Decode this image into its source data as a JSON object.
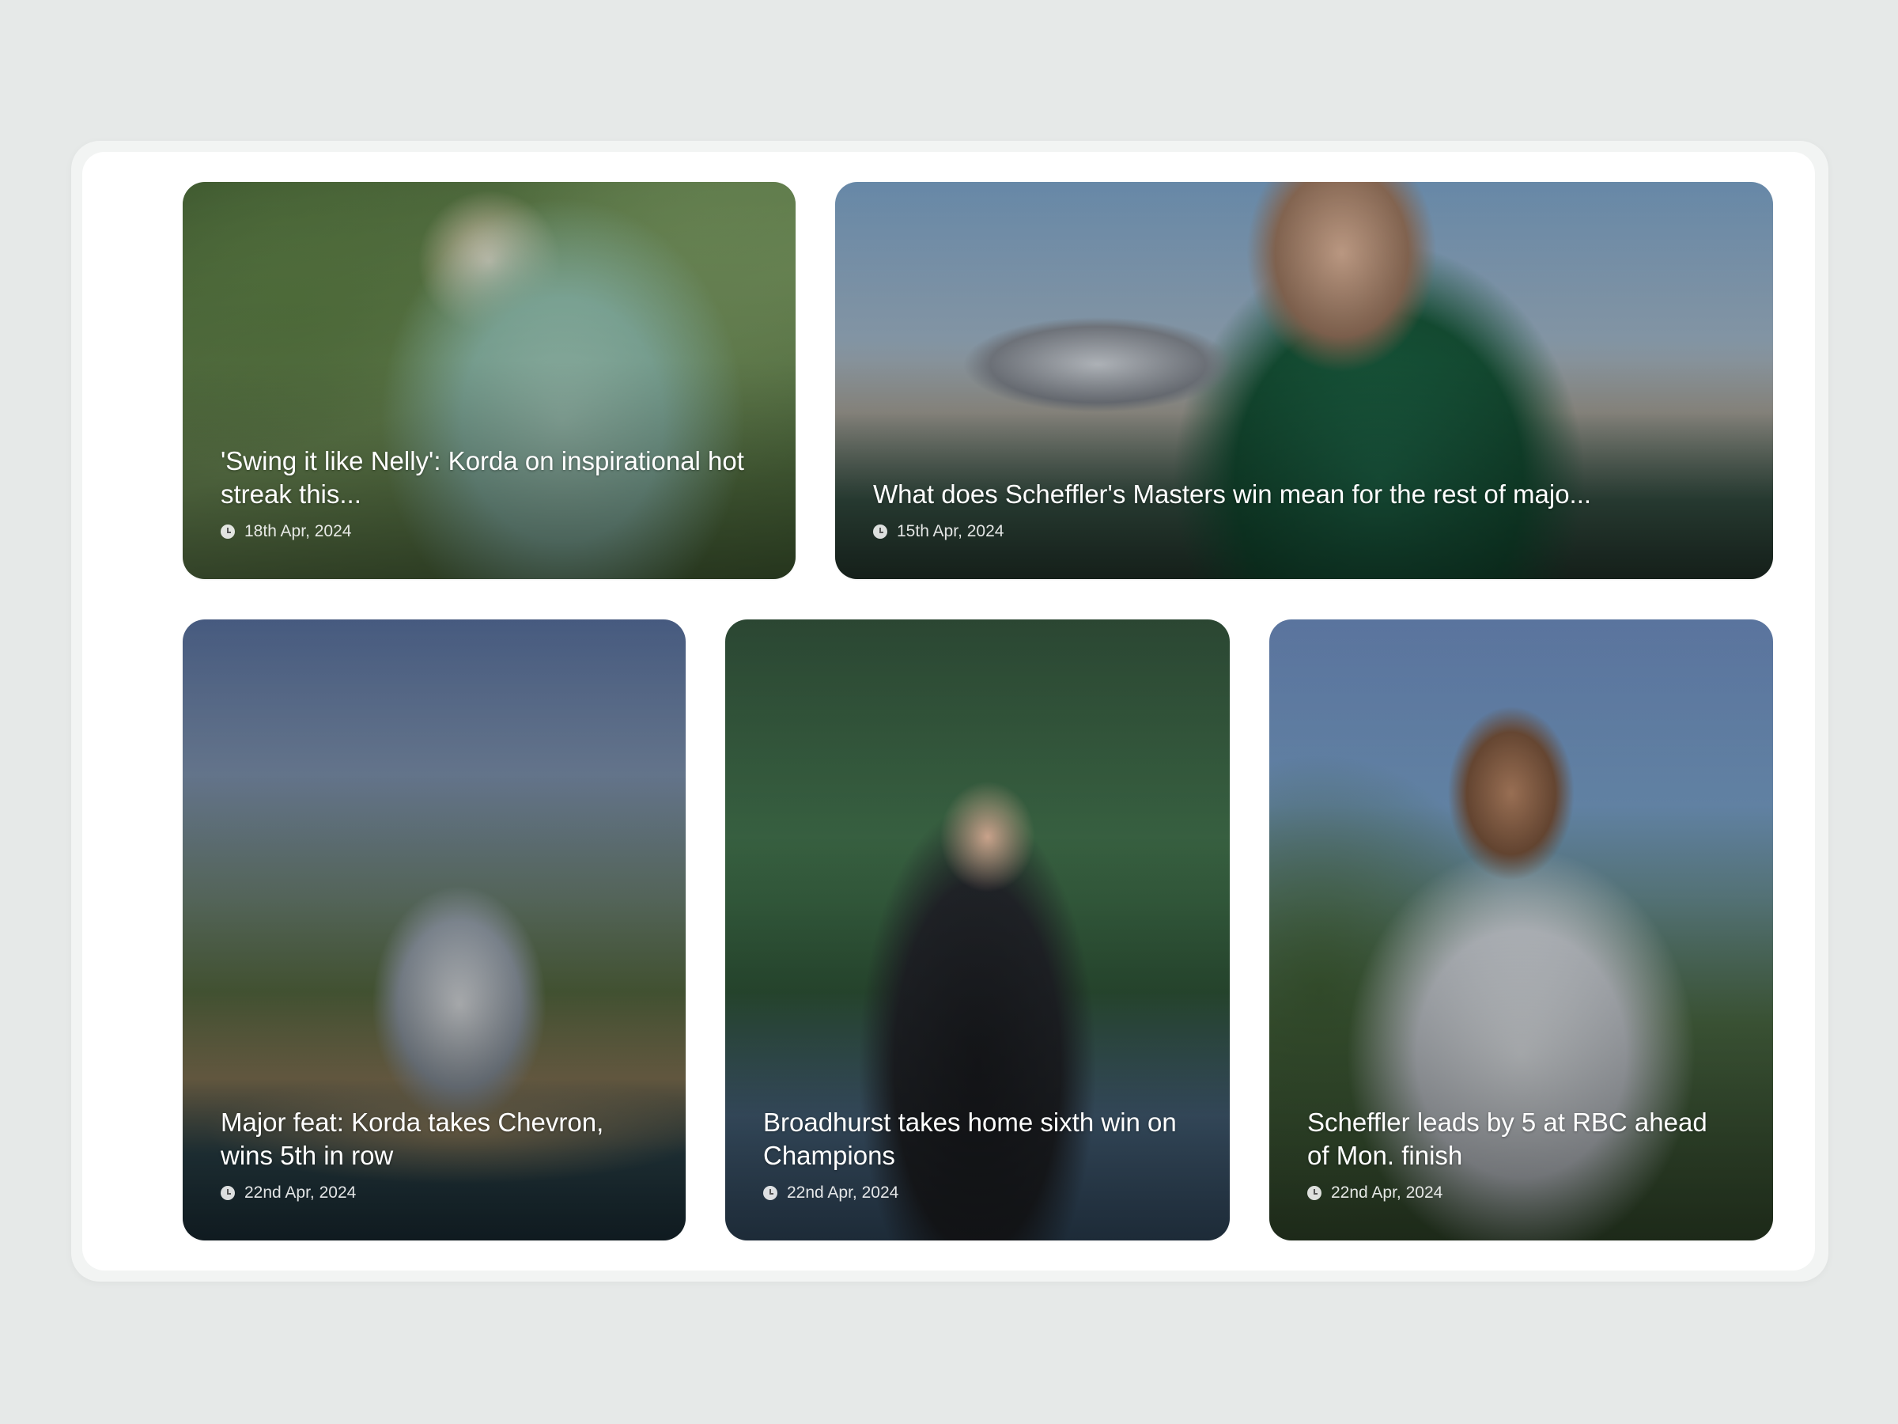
{
  "articles": [
    {
      "title": "'Swing it like Nelly': Korda on inspirational hot streak this...",
      "date": "18th Apr, 2024"
    },
    {
      "title": "What does Scheffler's Masters win mean for the rest of majo...",
      "date": "15th Apr, 2024"
    },
    {
      "title": "Major feat: Korda takes Chevron, wins 5th in row",
      "date": "22nd Apr, 2024"
    },
    {
      "title": "Broadhurst takes home sixth win on Champions",
      "date": "22nd Apr, 2024"
    },
    {
      "title": "Scheffler leads by 5 at RBC ahead of Mon. finish",
      "date": "22nd Apr, 2024"
    }
  ],
  "icons": {
    "date": "clock-icon"
  },
  "colors": {
    "page_background": "#e6e9e8",
    "panel_background": "#ffffff",
    "caption_text": "#ffffff"
  }
}
